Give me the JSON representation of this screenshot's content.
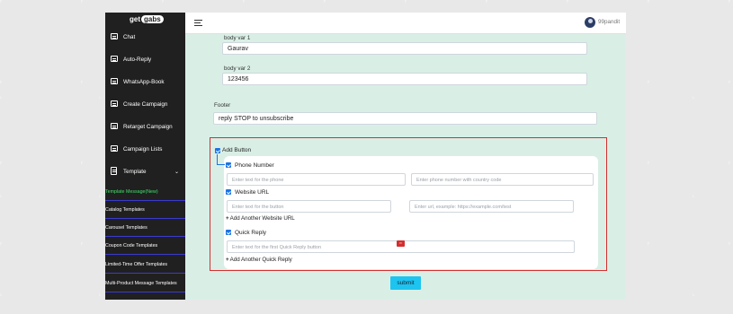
{
  "logo": {
    "get": "get",
    "gabs": "gabs"
  },
  "sidebar": {
    "items": [
      {
        "label": "Chat"
      },
      {
        "label": "Auto-Reply"
      },
      {
        "label": "WhatsApp-Book"
      },
      {
        "label": "Create Campaign"
      },
      {
        "label": "Retarget Campaign"
      },
      {
        "label": "Campaign Lists"
      }
    ],
    "template": {
      "label": "Template",
      "chevron": "⌄"
    },
    "template_items": [
      {
        "label": "Template Message(New)",
        "active": true
      },
      {
        "label": "Catalog Templates"
      },
      {
        "label": "Carousel Templates"
      },
      {
        "label": "Coupon Code Templates"
      },
      {
        "label": "Limited-Time Offer Templates"
      },
      {
        "label": "Multi-Product Message Templates"
      }
    ]
  },
  "header": {
    "username": "99pandit"
  },
  "form": {
    "body_var1": {
      "label": "body var 1",
      "value": "Gaurav"
    },
    "body_var2": {
      "label": "body var 2",
      "value": "123456"
    },
    "footer": {
      "label": "Footer",
      "value": "reply STOP to unsubscribe"
    },
    "add_button": {
      "label": "Add Button",
      "checked": true
    },
    "phone_number": {
      "label": "Phone Number",
      "text_placeholder": "Enter text for the phone",
      "number_placeholder": "Enter phone number with country code"
    },
    "website_url": {
      "label": "Website URL",
      "text_placeholder": "Enter text for the button",
      "url_placeholder": "Enter url, example: https://example.com/test",
      "add_label": "Add Another Website URL"
    },
    "quick_reply": {
      "label": "Quick Reply",
      "text_placeholder": "Enter text for the first Quick Reply button",
      "add_label": "Add Another Quick Reply"
    },
    "submit_label": "submit"
  },
  "colors": {
    "accent": "#1ec4f0",
    "highlight_border": "#d32f2f",
    "sidebar_bg": "#202020",
    "content_bg": "#d9efe6"
  }
}
